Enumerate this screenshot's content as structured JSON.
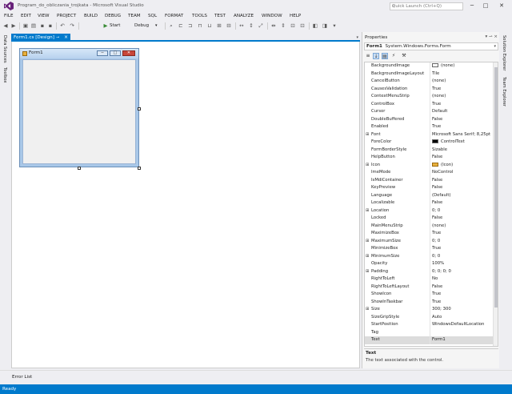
{
  "window": {
    "title": "Program_do_obliczania_trojkata - Microsoft Visual Studio",
    "quick_launch_placeholder": "Quick Launch (Ctrl+Q)",
    "controls": {
      "minimize": "─",
      "maximize": "□",
      "close": "✕"
    }
  },
  "menu": [
    "FILE",
    "EDIT",
    "VIEW",
    "PROJECT",
    "BUILD",
    "DEBUG",
    "TEAM",
    "SQL",
    "FORMAT",
    "TOOLS",
    "TEST",
    "ANALYZE",
    "WINDOW",
    "HELP"
  ],
  "toolbar": {
    "start_label": "Start",
    "config_label": "Debug"
  },
  "left_tabs": [
    "Data Sources",
    "Toolbox"
  ],
  "right_tabs": [
    "Solution Explorer",
    "Team Explorer"
  ],
  "document": {
    "tab_label": "Form1.cs [Design]",
    "form_title": "Form1"
  },
  "properties": {
    "panel_title": "Properties",
    "object_name": "Form1",
    "object_type": "System.Windows.Forms.Form",
    "rows": [
      {
        "name": "BackgroundImage",
        "value": "(none)",
        "swatch": "white",
        "expandable": false
      },
      {
        "name": "BackgroundImageLayout",
        "value": "Tile",
        "expandable": false
      },
      {
        "name": "CancelButton",
        "value": "(none)",
        "expandable": false
      },
      {
        "name": "CausesValidation",
        "value": "True",
        "expandable": false
      },
      {
        "name": "ContextMenuStrip",
        "value": "(none)",
        "expandable": false
      },
      {
        "name": "ControlBox",
        "value": "True",
        "expandable": false
      },
      {
        "name": "Cursor",
        "value": "Default",
        "expandable": false
      },
      {
        "name": "DoubleBuffered",
        "value": "False",
        "expandable": false
      },
      {
        "name": "Enabled",
        "value": "True",
        "expandable": false
      },
      {
        "name": "Font",
        "value": "Microsoft Sans Serif; 8,25pt",
        "expandable": true
      },
      {
        "name": "ForeColor",
        "value": "ControlText",
        "swatch": "black",
        "expandable": false
      },
      {
        "name": "FormBorderStyle",
        "value": "Sizable",
        "expandable": false
      },
      {
        "name": "HelpButton",
        "value": "False",
        "expandable": false
      },
      {
        "name": "Icon",
        "value": "(Icon)",
        "swatch": "icon",
        "expandable": true
      },
      {
        "name": "ImeMode",
        "value": "NoControl",
        "expandable": false
      },
      {
        "name": "IsMdiContainer",
        "value": "False",
        "expandable": false
      },
      {
        "name": "KeyPreview",
        "value": "False",
        "expandable": false
      },
      {
        "name": "Language",
        "value": "(Default)",
        "expandable": false
      },
      {
        "name": "Localizable",
        "value": "False",
        "expandable": false
      },
      {
        "name": "Location",
        "value": "0; 0",
        "expandable": true
      },
      {
        "name": "Locked",
        "value": "False",
        "expandable": false
      },
      {
        "name": "MainMenuStrip",
        "value": "(none)",
        "expandable": false
      },
      {
        "name": "MaximizeBox",
        "value": "True",
        "expandable": false
      },
      {
        "name": "MaximumSize",
        "value": "0; 0",
        "expandable": true
      },
      {
        "name": "MinimizeBox",
        "value": "True",
        "expandable": false
      },
      {
        "name": "MinimumSize",
        "value": "0; 0",
        "expandable": true
      },
      {
        "name": "Opacity",
        "value": "100%",
        "expandable": false
      },
      {
        "name": "Padding",
        "value": "0; 0; 0; 0",
        "expandable": true
      },
      {
        "name": "RightToLeft",
        "value": "No",
        "expandable": false
      },
      {
        "name": "RightToLeftLayout",
        "value": "False",
        "expandable": false
      },
      {
        "name": "ShowIcon",
        "value": "True",
        "expandable": false
      },
      {
        "name": "ShowInTaskbar",
        "value": "True",
        "expandable": false
      },
      {
        "name": "Size",
        "value": "300; 300",
        "expandable": true
      },
      {
        "name": "SizeGripStyle",
        "value": "Auto",
        "expandable": false
      },
      {
        "name": "StartPosition",
        "value": "WindowsDefaultLocation",
        "expandable": false
      },
      {
        "name": "Tag",
        "value": "",
        "expandable": false
      },
      {
        "name": "Text",
        "value": "Form1",
        "expandable": false,
        "selected": true
      }
    ],
    "description_title": "Text",
    "description_text": "The text associated with the control."
  },
  "bottom_tab": "Error List",
  "status": "Ready",
  "colors": {
    "accent": "#007acc",
    "chrome": "#eeeef2"
  }
}
